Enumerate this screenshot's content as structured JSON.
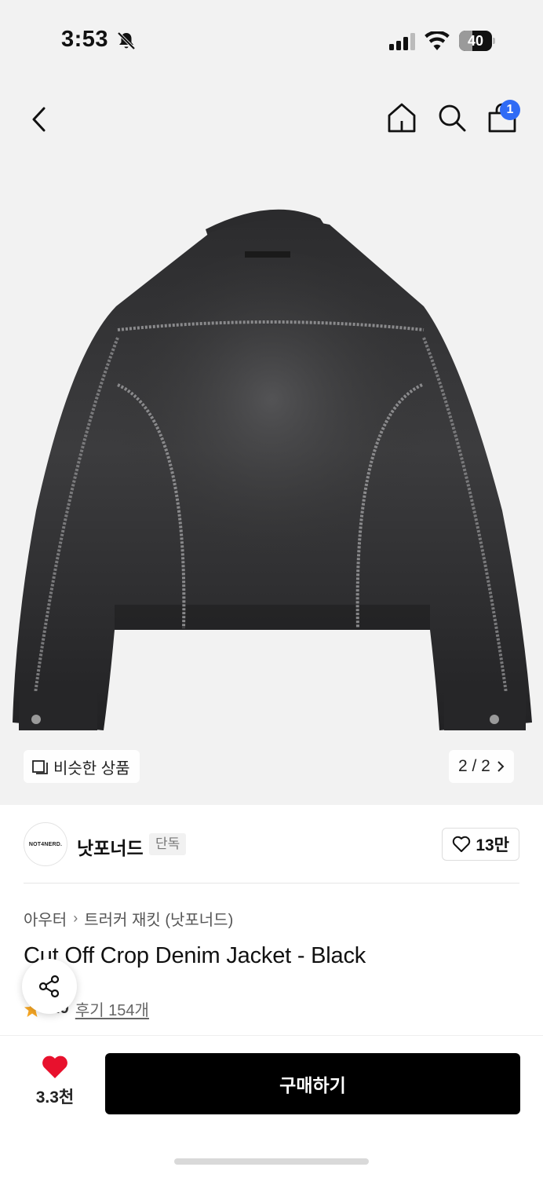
{
  "status_bar": {
    "time": "3:53",
    "battery_level": "40",
    "battery_fraction": 0.4,
    "icons": [
      "bell-slash-icon",
      "cellular-signal-icon",
      "wifi-icon",
      "battery-icon"
    ]
  },
  "top_nav": {
    "icons": [
      "back-chevron-icon",
      "home-icon",
      "search-icon",
      "shopping-bag-icon"
    ],
    "cart_badge": "1"
  },
  "gallery": {
    "similar_label": "비슷한 상품",
    "pager": "2 / 2",
    "pager_icon": "chevron-right-icon",
    "image": "black-cropped-denim-jacket-back-view"
  },
  "brand": {
    "logo_text": "NOT4NERD.",
    "name": "낫포너드",
    "tag": "단독",
    "likes": "13만"
  },
  "product": {
    "breadcrumb": [
      "아우터",
      "트러커 재킷 (낫포너드)"
    ],
    "title": "Cut Off Crop Denim Jacket - Black",
    "rating": "4.9",
    "reviews": "후기 154개"
  },
  "bottom_bar": {
    "wish_count": "3.3천",
    "buy_label": "구매하기"
  },
  "colors": {
    "badge": "#2f6bf5",
    "wish_heart": "#e8112d",
    "star": "#f6a623",
    "buy_button": "#000000"
  }
}
